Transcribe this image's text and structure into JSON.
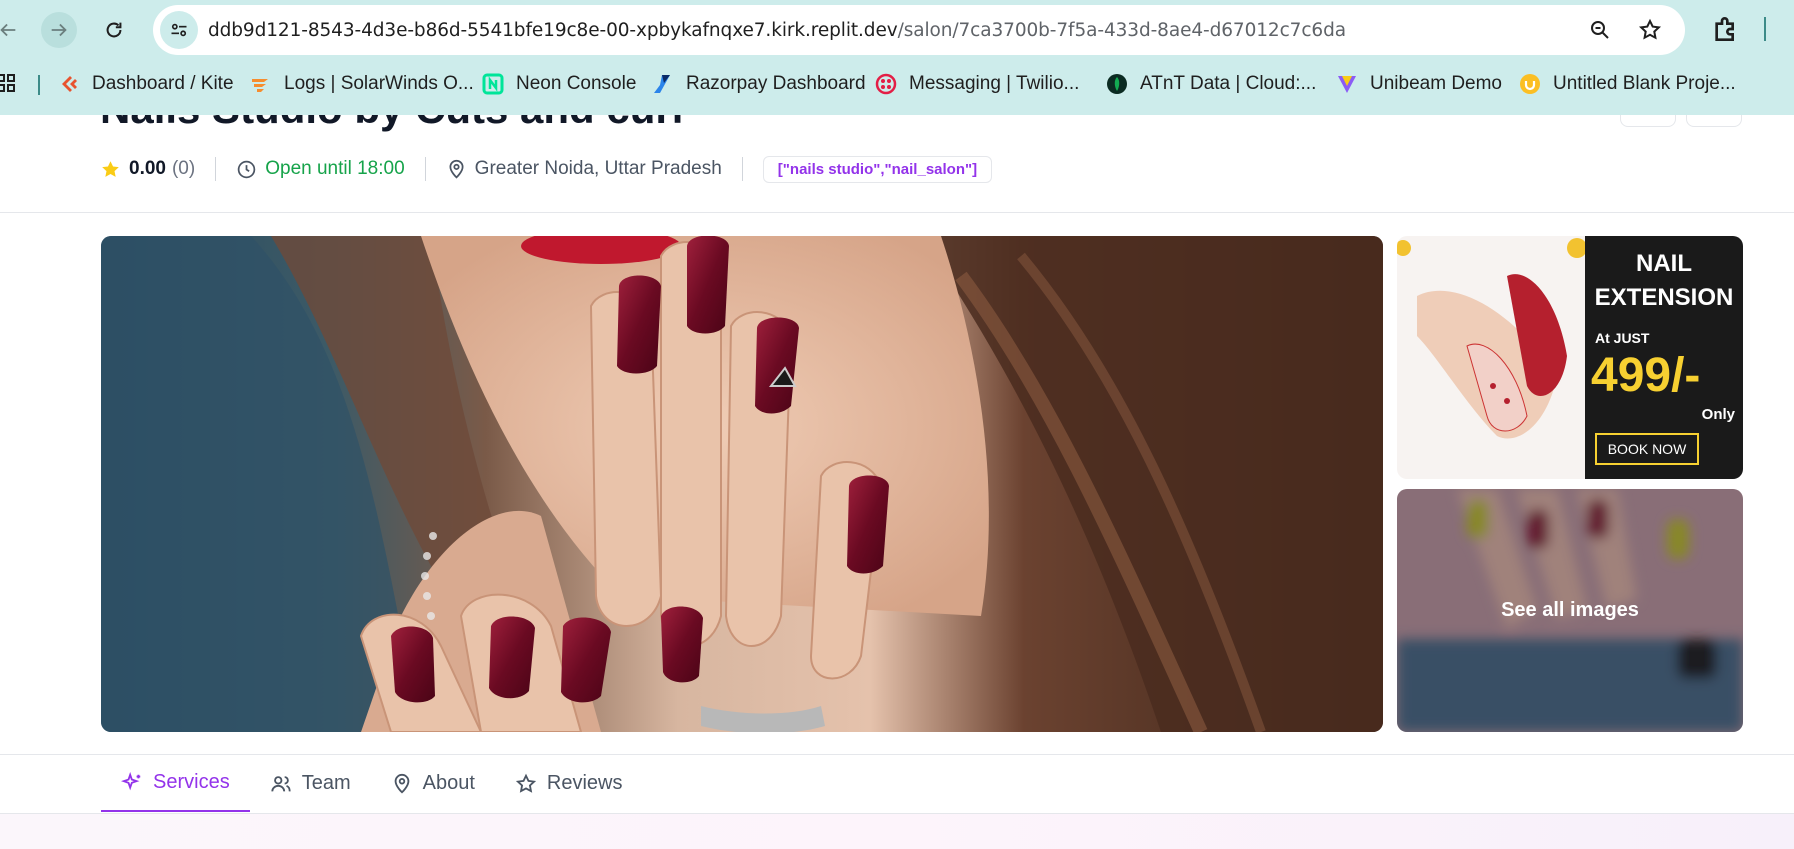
{
  "browser": {
    "url_host": "ddb9d121-8543-4d3e-b86d-5541bfe19c8e-00-xpbykafnqxe7.kirk.replit.dev",
    "url_path": "/salon/7ca3700b-7f5a-433d-8ae4-d67012c7c6da",
    "bookmarks": [
      {
        "label": "Dashboard / Kite",
        "icon": "kite-icon"
      },
      {
        "label": "Logs | SolarWinds O...",
        "icon": "solarwinds-icon"
      },
      {
        "label": "Neon Console",
        "icon": "neon-icon"
      },
      {
        "label": "Razorpay Dashboard",
        "icon": "razorpay-icon"
      },
      {
        "label": "Messaging | Twilio...",
        "icon": "twilio-icon"
      },
      {
        "label": "ATnT Data | Cloud:...",
        "icon": "mongodb-icon"
      },
      {
        "label": "Unibeam Demo",
        "icon": "unibeam-icon"
      },
      {
        "label": "Untitled Blank Proje...",
        "icon": "project-icon"
      }
    ]
  },
  "salon": {
    "name": "Nails Studio by Cuts and curl",
    "rating": "0.00",
    "review_count": "(0)",
    "hours": "Open until 18:00",
    "location": "Greater Noida, Uttar Pradesh",
    "tags": "[\"nails studio\",\"nail_salon\"]"
  },
  "gallery": {
    "promo_line1": "NAIL",
    "promo_line2": "EXTENSION",
    "promo_at_just": "At JUST",
    "promo_price": "499/-",
    "promo_only": "Only",
    "promo_book": "BOOK NOW",
    "see_all_label": "See all images"
  },
  "tabs": [
    {
      "label": "Services",
      "active": true
    },
    {
      "label": "Team",
      "active": false
    },
    {
      "label": "About",
      "active": false
    },
    {
      "label": "Reviews",
      "active": false
    }
  ],
  "colors": {
    "accent": "#9333ea",
    "open_green": "#16a34a",
    "star": "#facc15",
    "chrome_bg": "#cdeceb"
  }
}
